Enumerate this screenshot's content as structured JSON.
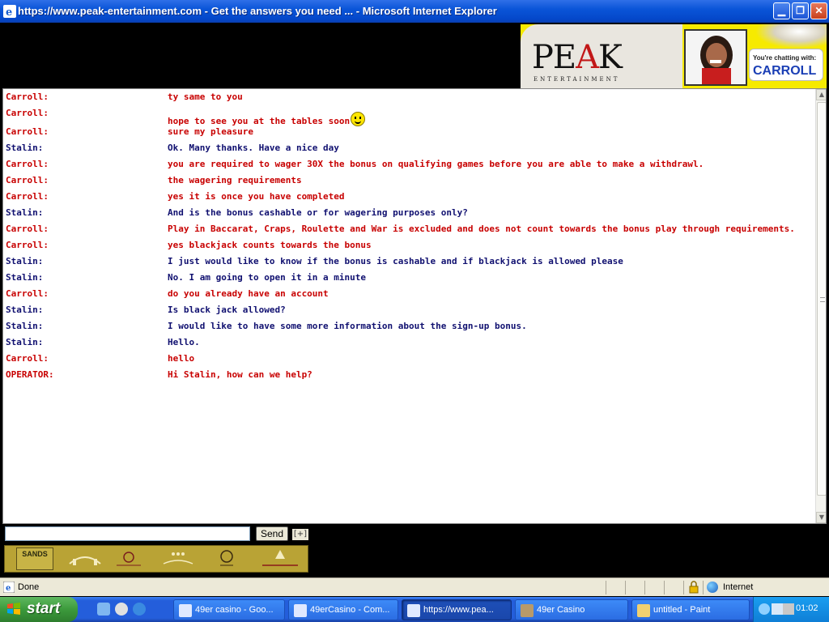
{
  "window": {
    "title": "https://www.peak-entertainment.com - Get the answers you need ... - Microsoft Internet Explorer"
  },
  "banner": {
    "logo_main_left": "PE",
    "logo_main_accent": "A",
    "logo_main_right": "K",
    "logo_sub": "ENTERTAINMENT",
    "chatting_label": "You're chatting with:",
    "agent_name": "CARROLL"
  },
  "chat": {
    "messages": [
      {
        "sender": "Carroll:",
        "text": "ty same to you",
        "color": "red"
      },
      {
        "sender": "Carroll:",
        "text": "hope to see you at the tables soon",
        "color": "red",
        "smiley": true
      },
      {
        "sender": "Carroll:",
        "text": "sure my pleasure",
        "color": "red"
      },
      {
        "sender": "Stalin:",
        "text": "Ok. Many thanks. Have a nice day",
        "color": "blue"
      },
      {
        "sender": "Carroll:",
        "text": "you are required to wager 30X the bonus on qualifying games before you are able to make a withdrawl.",
        "color": "red"
      },
      {
        "sender": "Carroll:",
        "text": "the wagering requirements",
        "color": "red"
      },
      {
        "sender": "Carroll:",
        "text": "yes it is once you have completed",
        "color": "red"
      },
      {
        "sender": "Stalin:",
        "text": "And is the bonus cashable or for wagering purposes only?",
        "color": "blue"
      },
      {
        "sender": "Carroll:",
        "text": "Play in Baccarat, Craps, Roulette and War is excluded and does not count towards the bonus play through requirements.",
        "color": "red"
      },
      {
        "sender": "Carroll:",
        "text": "yes blackjack counts towards the bonus",
        "color": "red"
      },
      {
        "sender": "Stalin:",
        "text": "I just would like to know if the bonus is cashable and if blackjack is allowed please",
        "color": "blue"
      },
      {
        "sender": "Stalin:",
        "text": "No. I am going to open it in a minute",
        "color": "blue"
      },
      {
        "sender": "Carroll:",
        "text": "do you already have an account",
        "color": "red"
      },
      {
        "sender": "Stalin:",
        "text": "Is black jack allowed?",
        "color": "blue"
      },
      {
        "sender": "Stalin:",
        "text": "I would like to have some more information about the sign-up bonus.",
        "color": "blue"
      },
      {
        "sender": "Stalin:",
        "text": "Hello.",
        "color": "blue"
      },
      {
        "sender": "Carroll:",
        "text": "hello",
        "color": "red"
      },
      {
        "sender": "OPERATOR:",
        "text": "Hi Stalin, how can we help?",
        "color": "red"
      }
    ]
  },
  "input": {
    "value": "",
    "send_label": "Send",
    "expand_label": "[+]"
  },
  "sponsors": {
    "sands_label": "SANDS"
  },
  "statusbar": {
    "status": "Done",
    "zone": "Internet"
  },
  "taskbar": {
    "start_label": "start",
    "tasks": [
      {
        "label": "49er casino - Goo...",
        "active": false
      },
      {
        "label": "49erCasino - Com...",
        "active": false
      },
      {
        "label": "https://www.pea...",
        "active": true
      },
      {
        "label": "49er Casino",
        "active": false
      },
      {
        "label": "untitled - Paint",
        "active": false
      }
    ],
    "clock": "01:02"
  },
  "colors": {
    "sender_red": "#c80000",
    "sender_blue": "#101070",
    "banner_yellow": "#f6ea00",
    "agent_name_blue": "#1b3fb5"
  }
}
